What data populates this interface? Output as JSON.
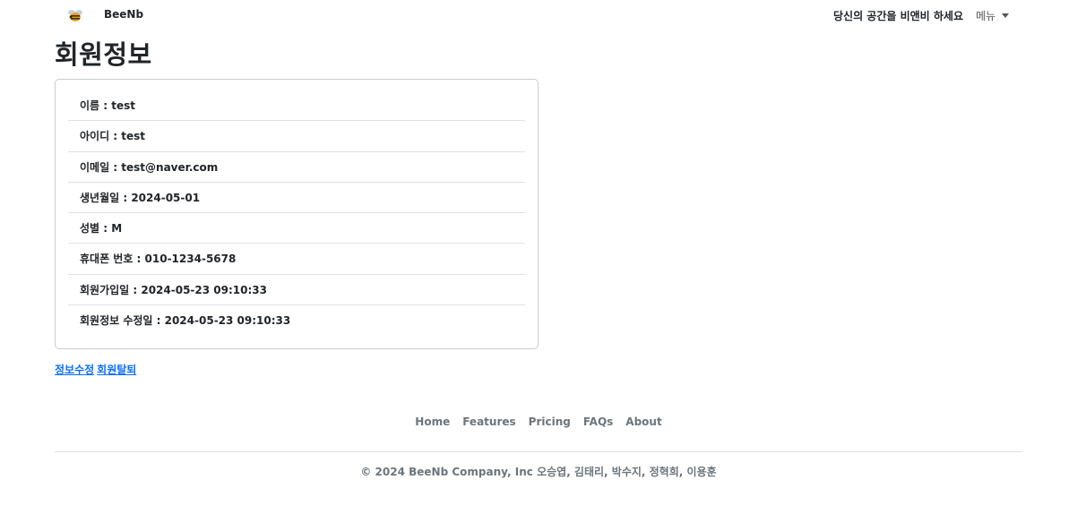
{
  "header": {
    "brand": "BeeNb",
    "tagline": "당신의 공간을 비앤비 하세요",
    "menu_label": "메뉴"
  },
  "page": {
    "title": "회원정보"
  },
  "info_items": [
    "이름 : test",
    "아이디 : test",
    "이메일 : test@naver.com",
    "생년월일 : 2024-05-01",
    "성별 : M",
    "휴대폰 번호 : 010-1234-5678",
    "회원가입일 : 2024-05-23 09:10:33",
    "회원정보 수정일 : 2024-05-23 09:10:33"
  ],
  "actions": {
    "edit_label": "정보수정",
    "withdraw_label": "회원탈퇴"
  },
  "footer": {
    "nav": [
      "Home",
      "Features",
      "Pricing",
      "FAQs",
      "About"
    ],
    "copyright": "© 2024 BeeNb Company, Inc 오승엽, 김태리, 박수지, 정혁희, 이용훈"
  },
  "colors": {
    "link": "#0d6efd",
    "muted": "#6c757d",
    "border": "#c9ccd0"
  },
  "icons": {
    "logo": "bee-icon",
    "menu_caret": "caret-down-icon"
  }
}
